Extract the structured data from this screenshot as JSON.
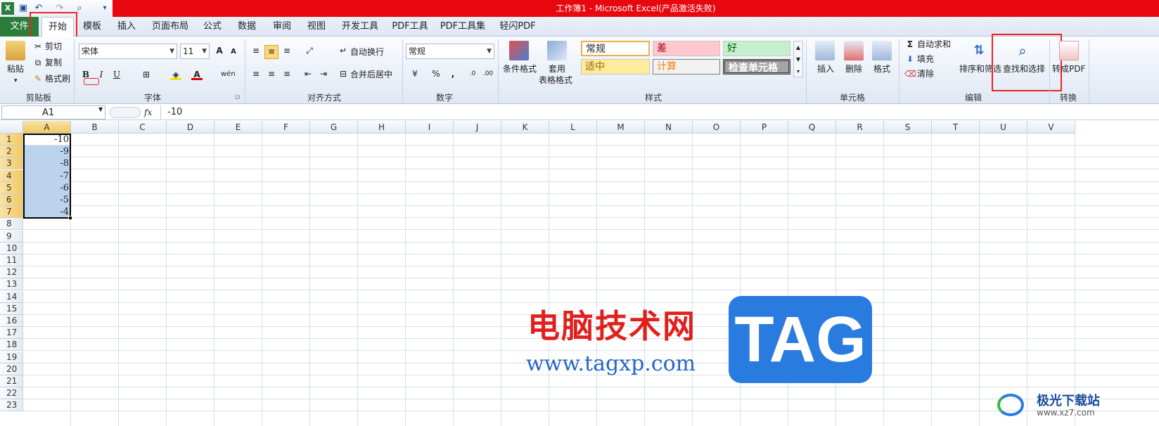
{
  "title": "工作簿1 - Microsoft Excel(产品激活失败)",
  "tabs": [
    "文件",
    "开始",
    "模板",
    "插入",
    "页面布局",
    "公式",
    "数据",
    "审阅",
    "视图",
    "开发工具",
    "PDF工具",
    "PDF工具集",
    "轻闪PDF"
  ],
  "clipboard": {
    "paste": "粘贴",
    "cut": "剪切",
    "copy": "复制",
    "format_painter": "格式刷",
    "label": "剪贴板"
  },
  "font": {
    "name": "宋体",
    "size": "11",
    "label": "字体",
    "bold": "B",
    "italic": "I",
    "underline": "U"
  },
  "alignment": {
    "wrap": "自动换行",
    "merge": "合并后居中",
    "label": "对齐方式"
  },
  "number": {
    "format": "常规",
    "percent": "%",
    "comma": ",",
    "label": "数字"
  },
  "styles": {
    "cond_format": "条件格式",
    "table_format_1": "套用",
    "table_format_2": "表格格式",
    "normal": "常规",
    "bad": "差",
    "good": "好",
    "neutral": "适中",
    "calc": "计算",
    "check": "检查单元格",
    "label": "样式",
    "colors": {
      "bad_bg": "#ffc7ce",
      "good_bg": "#c6efce",
      "neutral_bg": "#ffeb9c",
      "check_bg": "#a5a5a5"
    }
  },
  "cells": {
    "insert": "插入",
    "delete": "删除",
    "format": "格式",
    "label": "单元格"
  },
  "editing": {
    "autosum": "自动求和",
    "fill": "填充",
    "clear": "清除",
    "sort": "排序和筛选",
    "find": "查找和选择",
    "label": "编辑"
  },
  "convert": {
    "to_pdf": "转成PDF",
    "label": "转换"
  },
  "formula_bar": {
    "name": "A1",
    "fx": "fx",
    "value": "-10"
  },
  "columns": [
    "A",
    "B",
    "C",
    "D",
    "E",
    "F",
    "G",
    "H",
    "I",
    "J",
    "K",
    "L",
    "M",
    "N",
    "O",
    "P",
    "Q",
    "R",
    "S",
    "T",
    "U",
    "V"
  ],
  "rows": [
    "1",
    "2",
    "3",
    "4",
    "5",
    "6",
    "7",
    "8",
    "9",
    "10",
    "11",
    "12",
    "13",
    "14",
    "15",
    "16",
    "17",
    "18",
    "19",
    "20",
    "21",
    "22",
    "23"
  ],
  "cell_values": [
    "-10",
    "-9",
    "-8",
    "-7",
    "-6",
    "-5",
    "-4"
  ],
  "watermark": {
    "cn": "电脑技术网",
    "url": "www.tagxp.com",
    "tag": "TAG",
    "site2": "极光下载站",
    "site2_url": "www.xz7.com"
  },
  "accent": "#2d7d3a"
}
